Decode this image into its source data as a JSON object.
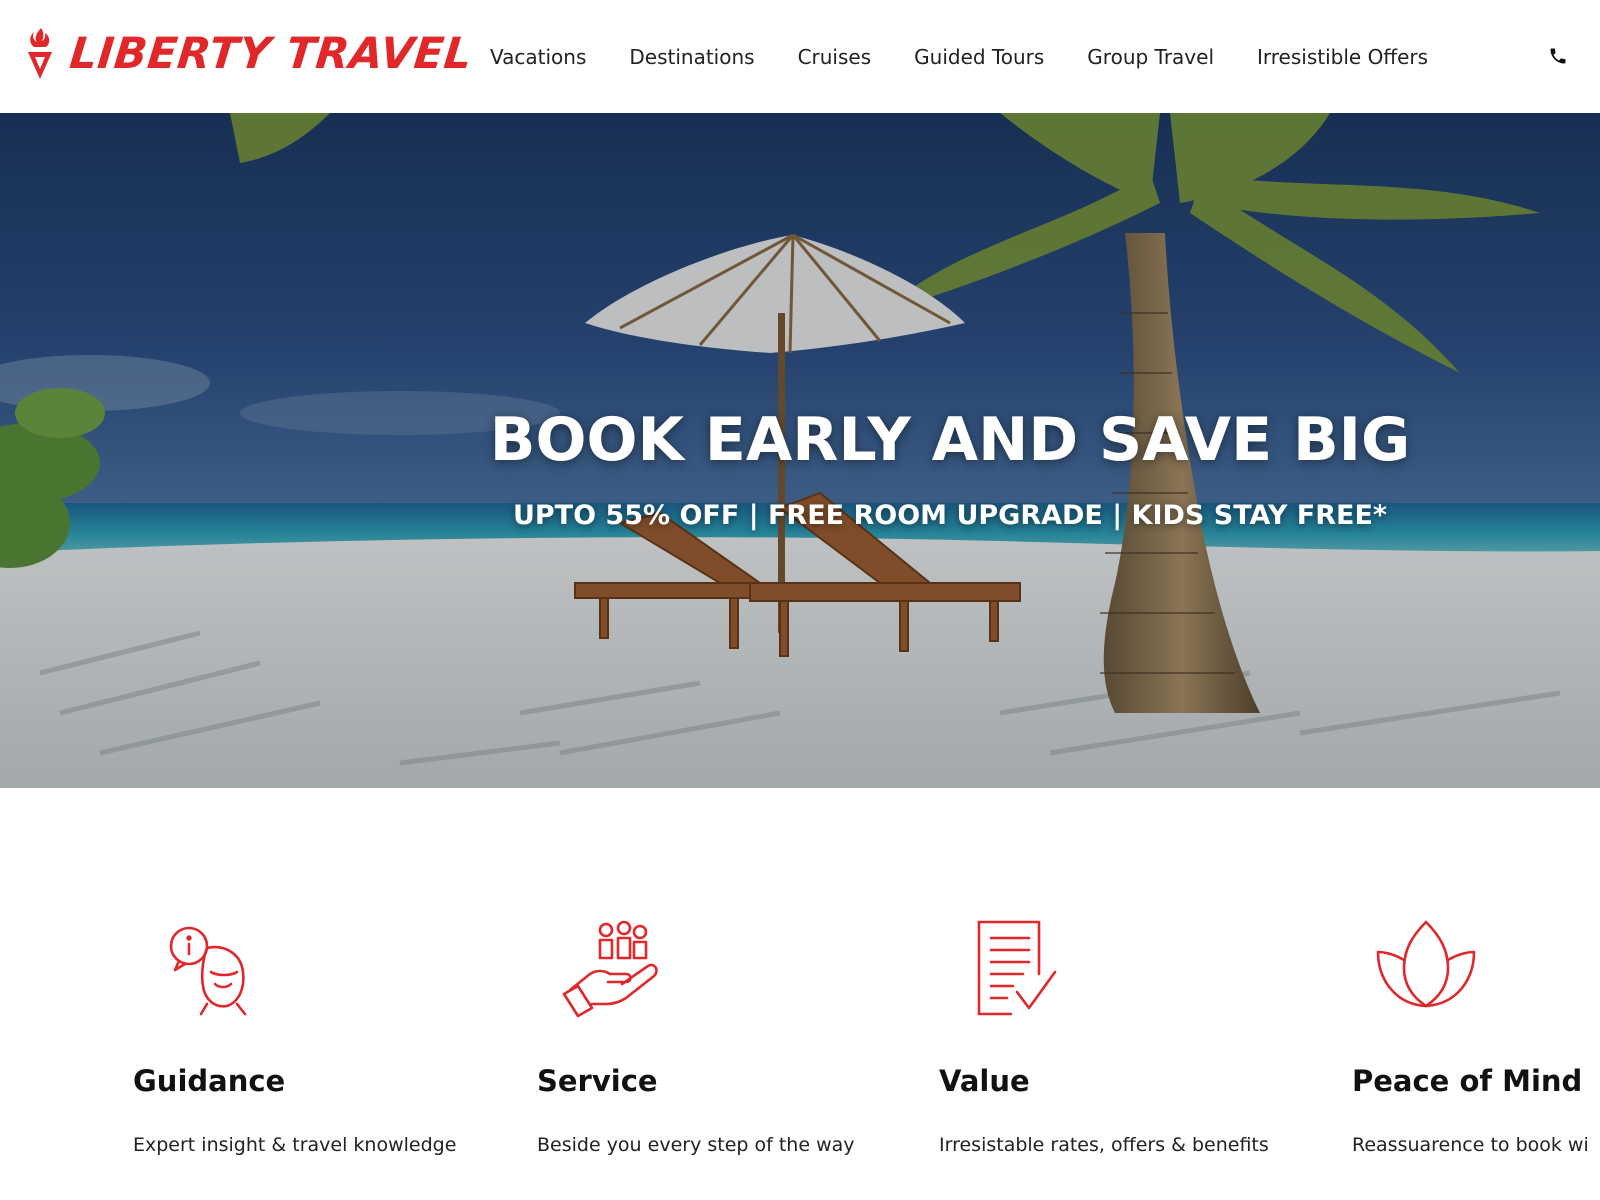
{
  "brand": {
    "name": "LIBERTY TRAVEL",
    "accent_color": "#e0272a"
  },
  "nav": {
    "items": [
      {
        "label": "Vacations"
      },
      {
        "label": "Destinations"
      },
      {
        "label": "Cruises"
      },
      {
        "label": "Guided Tours"
      },
      {
        "label": "Group Travel"
      },
      {
        "label": "Irresistible Offers"
      }
    ],
    "phone_icon": "phone-icon"
  },
  "hero": {
    "title": "BOOK EARLY AND SAVE BIG",
    "subtitle": "UPTO 55% OFF | FREE ROOM UPGRADE | KIDS STAY FREE*",
    "image": "beach-umbrella-loungers-palm"
  },
  "features": [
    {
      "icon": "guidance-icon",
      "title": "Guidance",
      "desc": "Expert insight & travel knowledge"
    },
    {
      "icon": "service-icon",
      "title": "Service",
      "desc": "Beside you every step of the way"
    },
    {
      "icon": "value-icon",
      "title": "Value",
      "desc": "Irresistable rates, offers & benefits"
    },
    {
      "icon": "lotus-icon",
      "title": "Peace of Mind",
      "desc": "Reassuarence to book wi"
    }
  ]
}
